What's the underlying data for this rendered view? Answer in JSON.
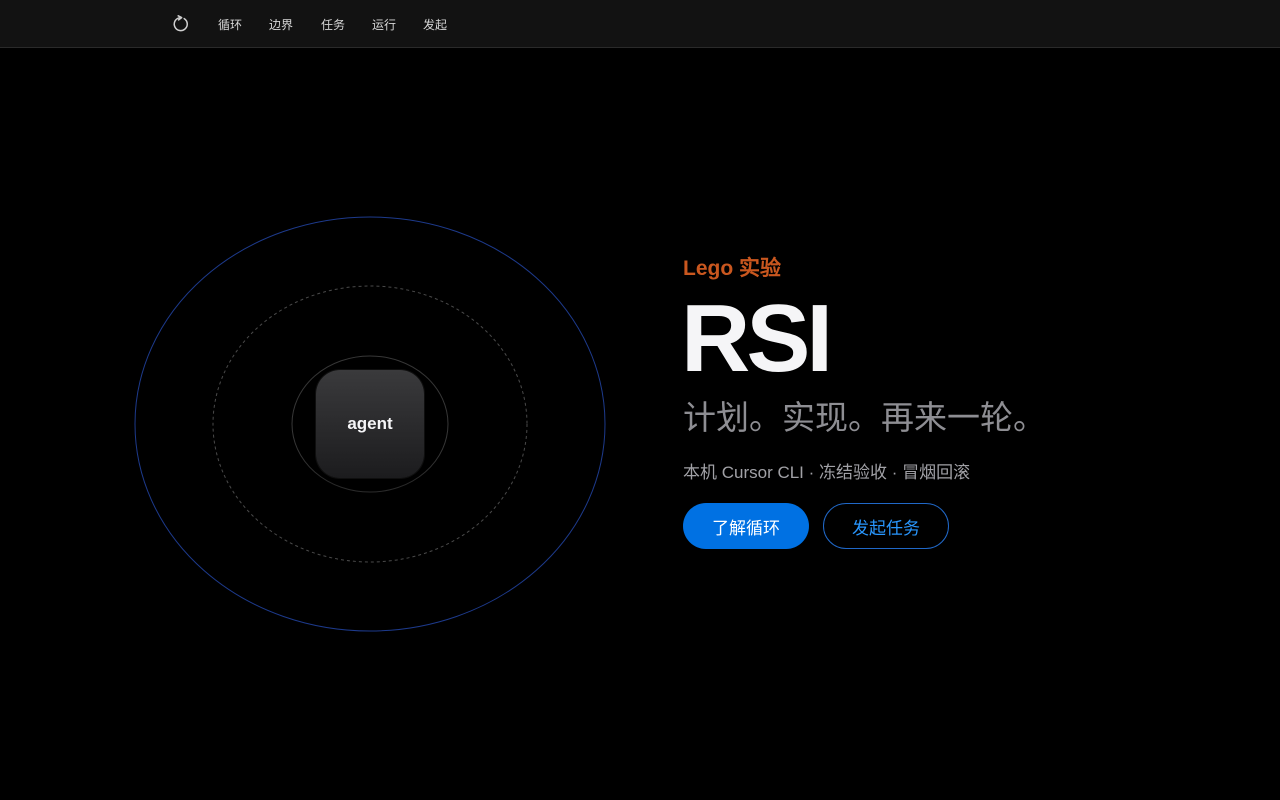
{
  "nav": {
    "links": [
      {
        "label": "循环"
      },
      {
        "label": "边界"
      },
      {
        "label": "任务"
      },
      {
        "label": "运行"
      },
      {
        "label": "发起"
      }
    ]
  },
  "graphic": {
    "agent_label": "agent"
  },
  "hero": {
    "eyebrow": "Lego 实验",
    "title": "RSI",
    "tagline": "计划。实现。再来一轮。",
    "subtitle": "本机 Cursor CLI · 冻结验收 · 冒烟回滚",
    "primary_button": "了解循环",
    "secondary_button": "发起任务"
  },
  "colors": {
    "accent_orange": "#c9571f",
    "primary_blue": "#0071e3",
    "link_blue": "#2997ff",
    "background": "#000000",
    "nav_background": "#121212"
  },
  "icons": {
    "logo": "refresh-icon"
  }
}
